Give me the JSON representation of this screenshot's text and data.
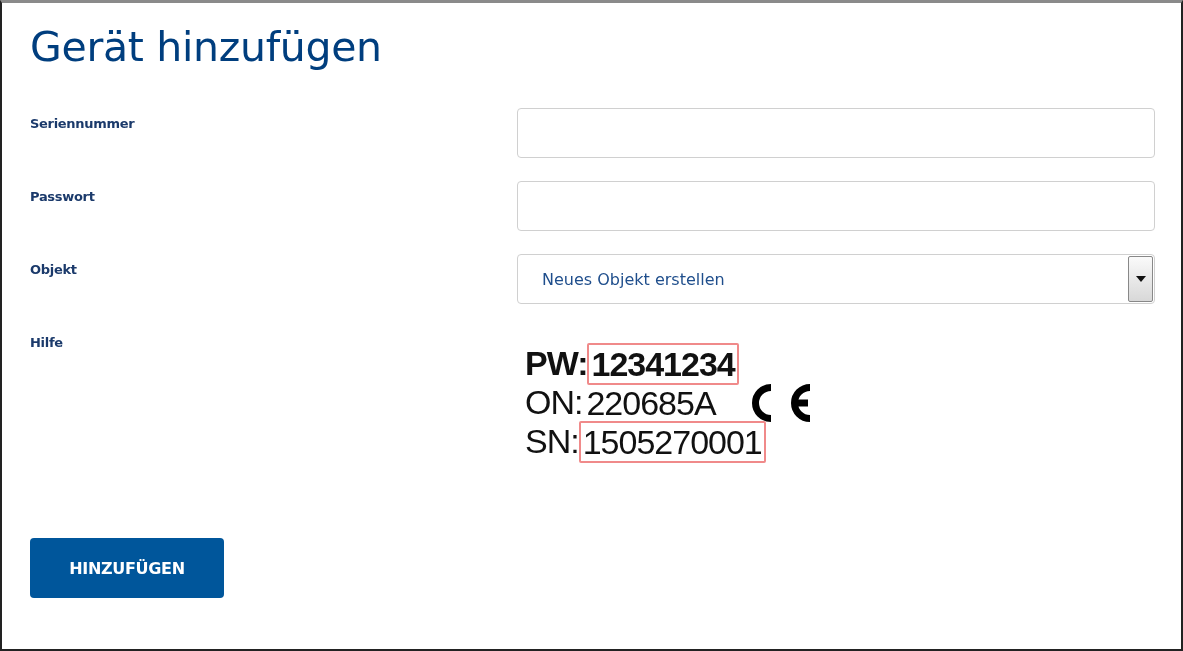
{
  "title": "Gerät hinzufügen",
  "fields": [
    {
      "kind": "text",
      "label": "Seriennummer"
    },
    {
      "kind": "password",
      "label": "Passwort"
    },
    {
      "kind": "select",
      "label": "Objekt",
      "value": "Neues Objekt erstellen"
    }
  ],
  "help": {
    "label": "Hilfe",
    "lines": [
      {
        "prefix": "PW:",
        "value": "12341234",
        "bold": true,
        "highlighted": true,
        "ce_mark": false
      },
      {
        "prefix": "ON:",
        "value": "220685A",
        "bold": false,
        "highlighted": false,
        "ce_mark": true
      },
      {
        "prefix": "SN:",
        "value": "1505270001",
        "bold": false,
        "highlighted": true,
        "ce_mark": false
      }
    ]
  },
  "submit_button": "HINZUFÜGEN"
}
